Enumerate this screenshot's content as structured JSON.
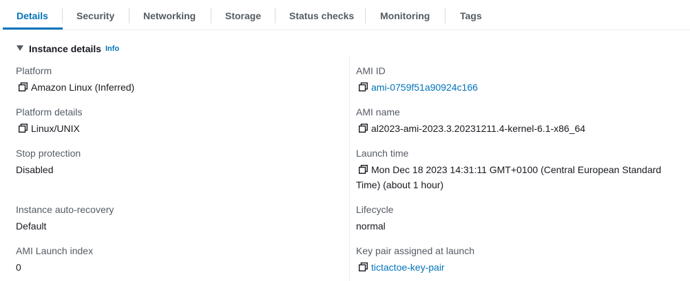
{
  "tabs": [
    "Details",
    "Security",
    "Networking",
    "Storage",
    "Status checks",
    "Monitoring",
    "Tags"
  ],
  "section": {
    "title": "Instance details",
    "info": "Info"
  },
  "left": {
    "platform": {
      "label": "Platform",
      "value": "Amazon Linux (Inferred)"
    },
    "platform_details": {
      "label": "Platform details",
      "value": "Linux/UNIX"
    },
    "stop_protection": {
      "label": "Stop protection",
      "value": "Disabled"
    },
    "auto_recovery": {
      "label": "Instance auto-recovery",
      "value": "Default"
    },
    "ami_launch_index": {
      "label": "AMI Launch index",
      "value": "0"
    }
  },
  "right": {
    "ami_id": {
      "label": "AMI ID",
      "value": "ami-0759f51a90924c166"
    },
    "ami_name": {
      "label": "AMI name",
      "value": "al2023-ami-2023.3.20231211.4-kernel-6.1-x86_64"
    },
    "launch_time": {
      "label": "Launch time",
      "value_line1": "Mon Dec 18 2023 14:31:11 GMT+0100 (Central European Standard",
      "value_line2": "Time) (about 1 hour)"
    },
    "lifecycle": {
      "label": "Lifecycle",
      "value": "normal"
    },
    "key_pair": {
      "label": "Key pair assigned at launch",
      "value": "tictactoe-key-pair"
    }
  },
  "colors": {
    "accent": "#0073bb",
    "text": "#16191f",
    "label": "#545b64",
    "border": "#eaeded"
  }
}
